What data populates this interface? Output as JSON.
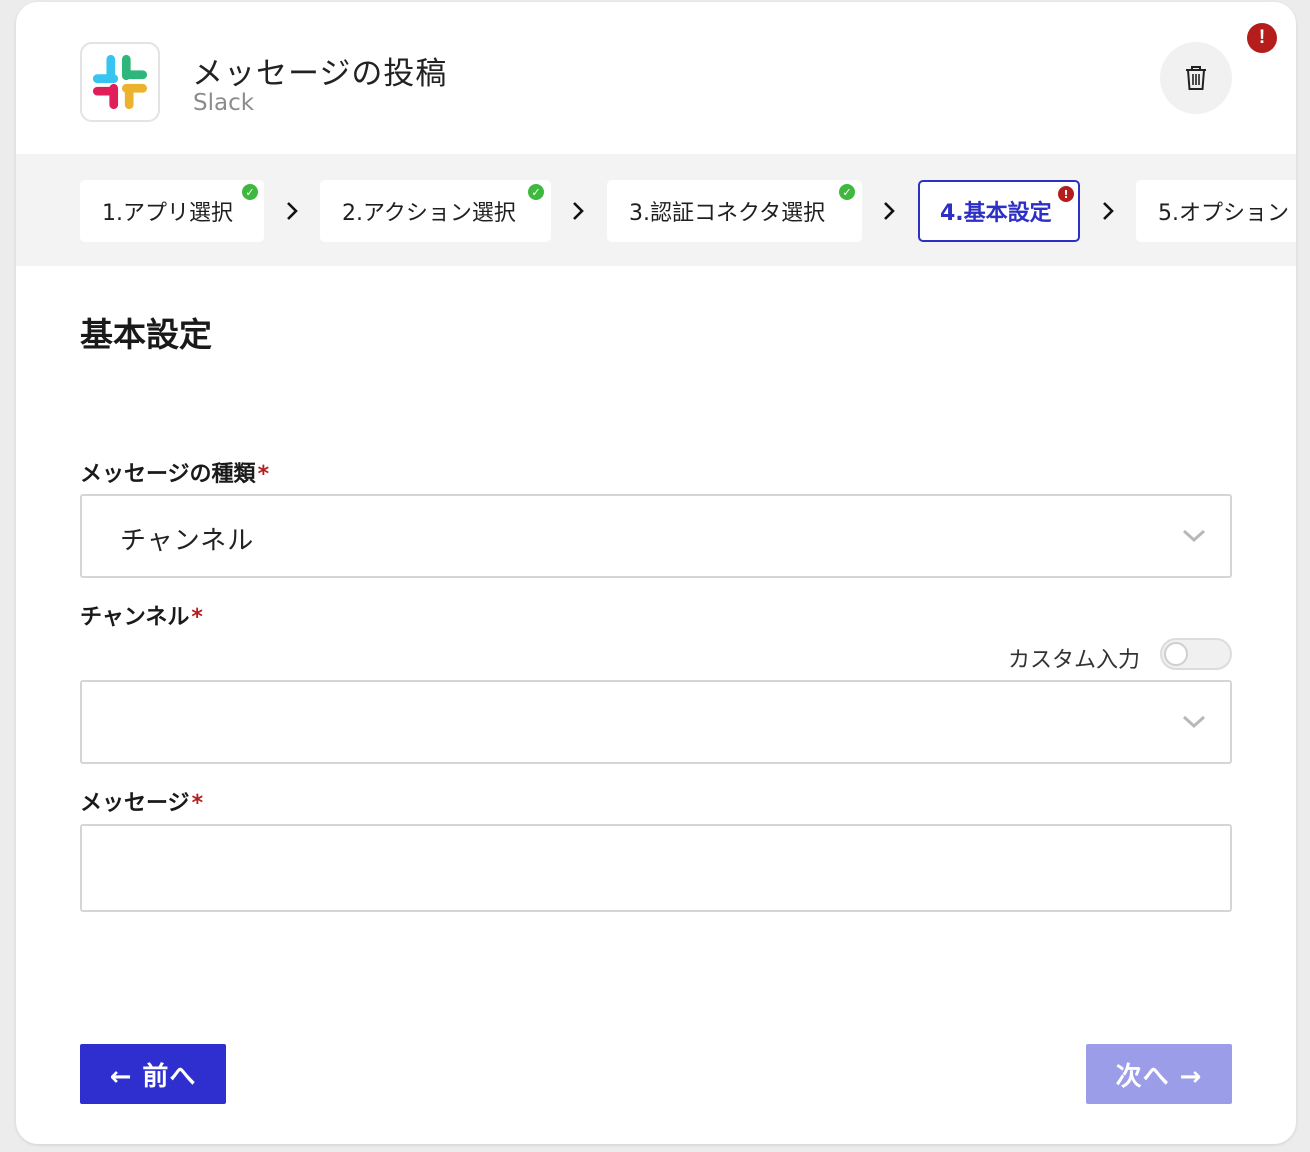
{
  "header": {
    "title": "メッセージの投稿",
    "subtitle": "Slack",
    "app_icon": "slack-logo",
    "delete_icon": "trash-icon",
    "error_icon": "error-icon"
  },
  "steps": [
    {
      "label": "1.アプリ選択",
      "status": "done"
    },
    {
      "label": "2.アクション選択",
      "status": "done"
    },
    {
      "label": "3.認証コネクタ選択",
      "status": "done"
    },
    {
      "label": "4.基本設定",
      "status": "error"
    },
    {
      "label": "5.オプション",
      "status": "pending"
    }
  ],
  "main": {
    "section_title": "基本設定",
    "message_type": {
      "label": "メッセージの種類",
      "required_mark": "*",
      "value": "チャンネル"
    },
    "channel": {
      "label": "チャンネル",
      "required_mark": "*",
      "custom_input_label": "カスタム入力",
      "custom_input_on": false,
      "value": ""
    },
    "message": {
      "label": "メッセージ",
      "required_mark": "*",
      "value": ""
    }
  },
  "footer": {
    "prev_label": "← 前へ",
    "next_label": "次へ →"
  },
  "colors": {
    "primary": "#2f2fd0",
    "primary_disabled": "#9c9de8",
    "error": "#b51d1d",
    "success": "#3fb83f"
  }
}
